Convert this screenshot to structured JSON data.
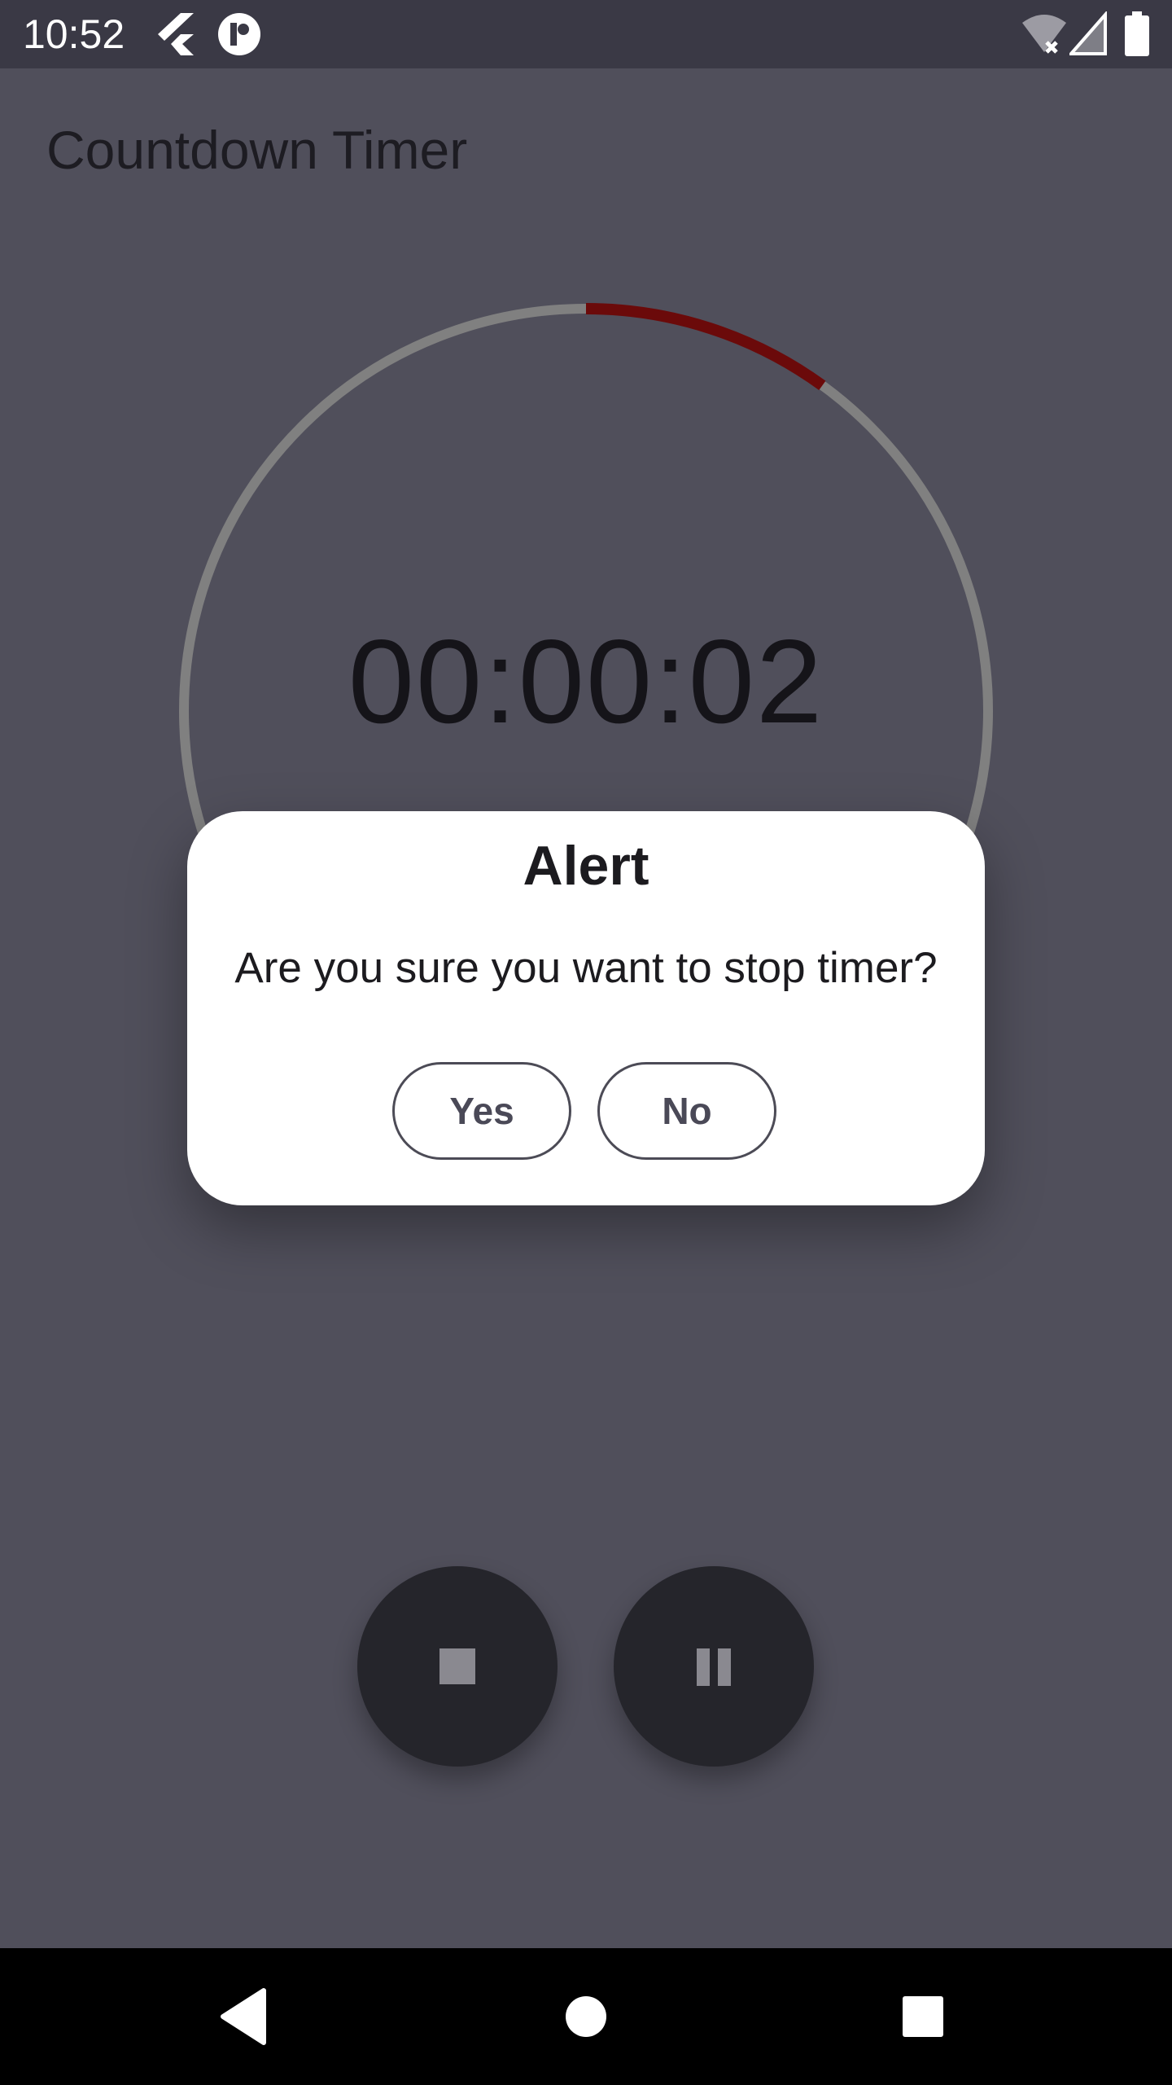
{
  "status_bar": {
    "time": "10:52",
    "icons": [
      "flutter-icon",
      "app-badge-icon",
      "wifi-off-icon",
      "signal-icon",
      "battery-icon"
    ]
  },
  "app": {
    "title": "Countdown Timer"
  },
  "timer": {
    "display": "00:00:02",
    "progress_fraction": 0.1,
    "ring_color": "#808080",
    "progress_color": "#6b0a0a"
  },
  "dialog": {
    "title": "Alert",
    "message": "Are you sure you want to stop timer?",
    "yes_label": "Yes",
    "no_label": "No"
  },
  "controls": {
    "stop_icon": "stop-icon",
    "pause_icon": "pause-icon"
  },
  "nav": {
    "icons": [
      "back-icon",
      "home-icon",
      "recents-icon"
    ]
  },
  "colors": {
    "background": "#504f5b",
    "status_bar": "#3a3945",
    "fab": "#25252b",
    "dialog": "#ffffff"
  }
}
